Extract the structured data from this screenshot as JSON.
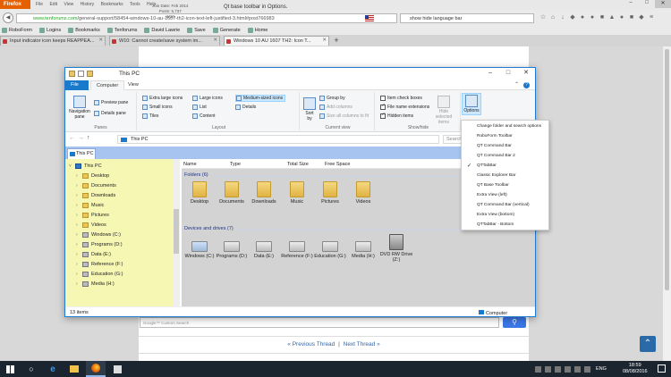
{
  "browser": {
    "menu_button": "Firefox",
    "menu": [
      "File",
      "Edit",
      "View",
      "History",
      "Bookmarks",
      "Tools",
      "Help"
    ],
    "url_host": "www.tenforums.com",
    "url_rest": "/general-support/58454-windows-10-au-1607-th2-icon-text-left-justified-3.html#post766983",
    "search_text": "show hide language bar",
    "bookmarks": [
      "RoboForm",
      "Logins",
      "Bookmarks",
      "Tenforums",
      "David Lawrie",
      "Save",
      "Generate",
      "Home"
    ],
    "tabs": [
      {
        "label": "Input indicator icon keeps REAPPEA...",
        "active": false
      },
      {
        "label": "W10: Cannot create/save system im...",
        "active": false
      },
      {
        "label": "Windows 10 AU 1607 TH2: Icon T...",
        "active": true
      }
    ],
    "window_controls": {
      "min": "–",
      "max": "□",
      "close": "✕"
    }
  },
  "webpage": {
    "post_meta": [
      "Join Date: Feb 2014",
      "Posts: 5,737",
      "W10"
    ],
    "qt_text": "Qt base toolbar in Options.",
    "google_search_placeholder": "Google™ Custom Search",
    "prev_thread": "« Previous Thread",
    "next_thread": "Next Thread »",
    "separator": "|"
  },
  "explorer": {
    "title": "This PC",
    "ribbon_tabs": [
      "File",
      "Computer",
      "View"
    ],
    "ribbon": {
      "navigation_pane": "Navigation pane",
      "preview_pane": "Preview pane",
      "details_pane": "Details pane",
      "panes_label": "Panes",
      "layout_items": [
        "Extra large icons",
        "Large icons",
        "Medium-sized icons",
        "Small icons",
        "List",
        "Details",
        "Tiles",
        "Content"
      ],
      "layout_label": "Layout",
      "sort_by": "Sort by",
      "group_by": "Group by",
      "add_columns": "Add columns",
      "size_all_columns": "Size all columns to fit",
      "current_view_label": "Current view",
      "item_check_boxes": "Item check boxes",
      "file_name_extensions": "File name extensions",
      "hidden_items": "Hidden items",
      "hide_selected_items": "Hide selected items",
      "show_hide_label": "Show/hide",
      "options": "Options"
    },
    "address": "This PC",
    "search_placeholder": "Search This PC",
    "qt_tab": "This PC",
    "nav_items": [
      {
        "label": "This PC",
        "level": 0,
        "icon": "pc"
      },
      {
        "label": "Desktop",
        "level": 1,
        "icon": "folder"
      },
      {
        "label": "Documents",
        "level": 1,
        "icon": "folder"
      },
      {
        "label": "Downloads",
        "level": 1,
        "icon": "folder"
      },
      {
        "label": "Music",
        "level": 1,
        "icon": "folder"
      },
      {
        "label": "Pictures",
        "level": 1,
        "icon": "folder"
      },
      {
        "label": "Videos",
        "level": 1,
        "icon": "folder"
      },
      {
        "label": "Windows (C:)",
        "level": 1,
        "icon": "drive"
      },
      {
        "label": "Programs (D:)",
        "level": 1,
        "icon": "drive"
      },
      {
        "label": "Data (E:)",
        "level": 1,
        "icon": "drive"
      },
      {
        "label": "Reference (F:)",
        "level": 1,
        "icon": "drive"
      },
      {
        "label": "Education (G:)",
        "level": 1,
        "icon": "drive"
      },
      {
        "label": "Media (H:)",
        "level": 1,
        "icon": "drive"
      }
    ],
    "columns": [
      "Name",
      "Type",
      "Total Size",
      "Free Space"
    ],
    "folders_header": "Folders (6)",
    "folders": [
      "Desktop",
      "Documents",
      "Downloads",
      "Music",
      "Pictures",
      "Videos"
    ],
    "drives_header": "Devices and drives (7)",
    "drives": [
      "Windows (C:)",
      "Programs (D:)",
      "Data (E:)",
      "Reference (F:)",
      "Education (G:)",
      "Media (H:)",
      "DVD RW Drive (Z:)"
    ],
    "status_count": "13 items",
    "status_location": "Computer"
  },
  "options_menu": [
    {
      "label": "Change folder and search options",
      "checked": false
    },
    {
      "label": "RoboForm Toolbar",
      "checked": false
    },
    {
      "label": "QT Command Bar",
      "checked": false
    },
    {
      "label": "QT Command Bar 2",
      "checked": false
    },
    {
      "label": "QTTabBar",
      "checked": true
    },
    {
      "label": "Classic Explorer Bar",
      "checked": false
    },
    {
      "label": "QT Base Toolbar",
      "checked": false
    },
    {
      "label": "Extra View (left)",
      "checked": false
    },
    {
      "label": "QT Command Bar (vertical)",
      "checked": false
    },
    {
      "label": "Extra View (bottom)",
      "checked": false
    },
    {
      "label": "QTTabBar - Bottom",
      "checked": false
    }
  ],
  "taskbar": {
    "language": "ENG",
    "time": "18:59",
    "date": "08/08/2016"
  }
}
